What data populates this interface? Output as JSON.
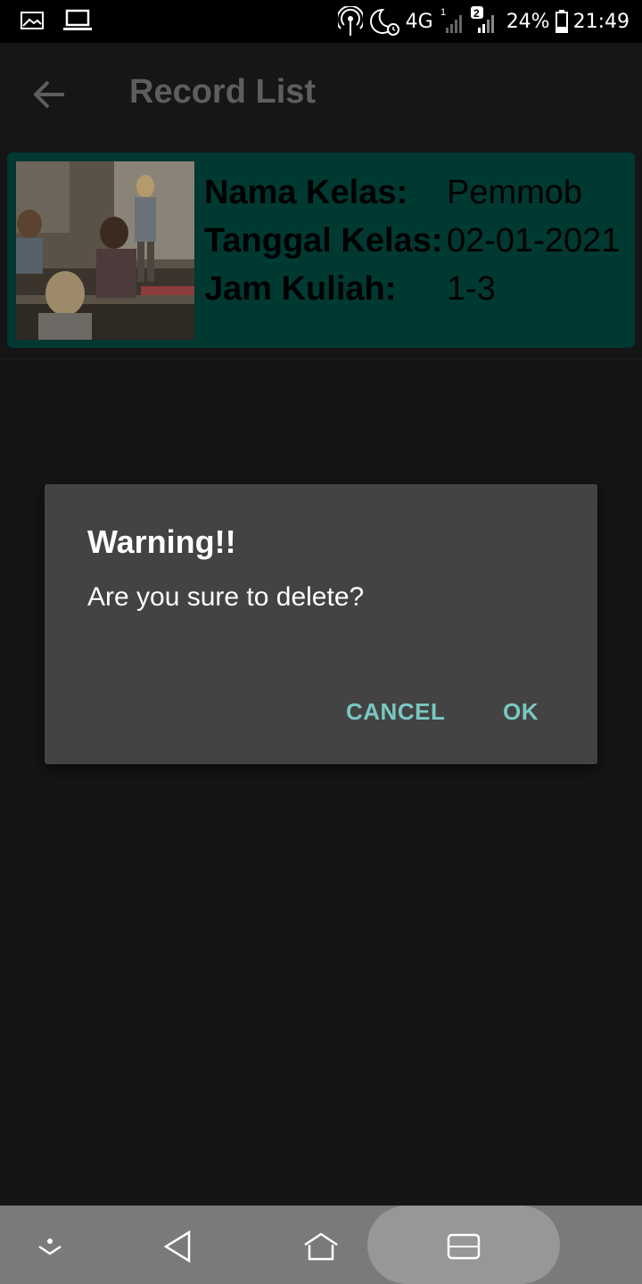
{
  "status_bar": {
    "icons_left": [
      "gallery-icon",
      "laptop-icon"
    ],
    "icons_right": [
      "hotspot-icon",
      "moon-alarm-icon",
      "signal-icon",
      "signal-2-icon",
      "battery-icon"
    ],
    "network": "4G",
    "sim1": "1",
    "sim2": "2",
    "battery": "24%",
    "time": "21:49"
  },
  "app_bar": {
    "title": "Record List"
  },
  "record": {
    "labels": {
      "nama": "Nama Kelas:",
      "tanggal": "Tanggal Kelas:",
      "jam": "Jam Kuliah:"
    },
    "values": {
      "nama": "Pemmob",
      "tanggal": "02-01-2021",
      "jam": "1-3"
    }
  },
  "dialog": {
    "title": "Warning!!",
    "message": "Are you sure to delete?",
    "cancel": "CANCEL",
    "ok": "OK"
  },
  "colors": {
    "card": "#003932",
    "dialog": "#434343",
    "accent": "#7ac7c2"
  }
}
